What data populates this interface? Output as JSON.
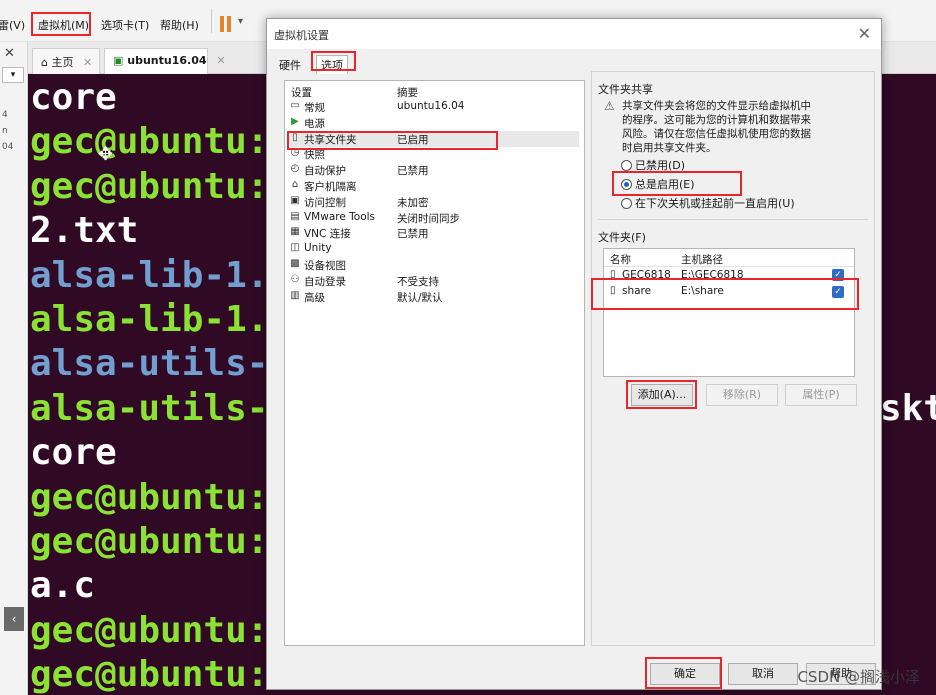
{
  "menubar": {
    "items": [
      "雷(V)",
      "虚拟机(M)",
      "选项卡(T)",
      "帮助(H)"
    ]
  },
  "left_strip": {
    "glyphs": [
      "4",
      "n",
      "04"
    ]
  },
  "tabs": [
    {
      "label": "主页"
    },
    {
      "label": "ubuntu16.04"
    }
  ],
  "terminal": {
    "lines": [
      {
        "text": "core",
        "color": "#ffffff"
      },
      {
        "text": "gec@ubuntu:",
        "color": "#8ae234"
      },
      {
        "text": "gec@ubuntu:",
        "color": "#8ae234"
      },
      {
        "text": "2.txt",
        "color": "#ffffff"
      },
      {
        "text": "alsa-lib-1.",
        "color": "#729fcf"
      },
      {
        "text": "alsa-lib-1.",
        "color": "#8ae234"
      },
      {
        "text": "alsa-utils-",
        "color": "#729fcf"
      },
      {
        "text": "alsa-utils-",
        "color": "#8ae234"
      },
      {
        "text": "core",
        "color": "#ffffff"
      },
      {
        "text": "gec@ubuntu:",
        "color": "#8ae234"
      },
      {
        "text": "gec@ubuntu:",
        "color": "#8ae234"
      },
      {
        "text": "a.c",
        "color": "#ffffff"
      },
      {
        "text": "gec@ubuntu:",
        "color": "#8ae234"
      },
      {
        "text": "gec@ubuntu:",
        "color": "#8ae234"
      }
    ],
    "right_fragment": "skt"
  },
  "dialog": {
    "title": "虚拟机设置",
    "tabs": [
      "硬件",
      "选项"
    ],
    "list_headers": [
      "设置",
      "摘要"
    ],
    "list_items": [
      {
        "icon": "monitor-icon",
        "glyph": "▭",
        "name": "常规",
        "summary": "ubuntu16.04"
      },
      {
        "icon": "power-icon",
        "glyph": "▶",
        "name": "电源",
        "summary": ""
      },
      {
        "icon": "shared-folder-icon",
        "glyph": "▯",
        "name": "共享文件夹",
        "summary": "已启用"
      },
      {
        "icon": "snapshot-icon",
        "glyph": "◷",
        "name": "快照",
        "summary": ""
      },
      {
        "icon": "autoprotect-icon",
        "glyph": "◴",
        "name": "自动保护",
        "summary": "已禁用"
      },
      {
        "icon": "guest-isolation-icon",
        "glyph": "⌂",
        "name": "客户机隔离",
        "summary": ""
      },
      {
        "icon": "access-control-icon",
        "glyph": "▣",
        "name": "访问控制",
        "summary": "未加密"
      },
      {
        "icon": "vmware-tools-icon",
        "glyph": "▤",
        "name": "VMware Tools",
        "summary": "关闭时间同步"
      },
      {
        "icon": "vnc-icon",
        "glyph": "▦",
        "name": "VNC 连接",
        "summary": "已禁用"
      },
      {
        "icon": "unity-icon",
        "glyph": "◫",
        "name": "Unity",
        "summary": ""
      },
      {
        "icon": "device-view-icon",
        "glyph": "▩",
        "name": "设备视图",
        "summary": ""
      },
      {
        "icon": "autologon-icon",
        "glyph": "⚇",
        "name": "自动登录",
        "summary": "不受支持"
      },
      {
        "icon": "advanced-icon",
        "glyph": "▥",
        "name": "高级",
        "summary": "默认/默认"
      }
    ],
    "sharing": {
      "group_label": "文件夹共享",
      "warning": [
        "共享文件夹会将您的文件显示给虚拟机中",
        "的程序。这可能为您的计算机和数据带来",
        "风险。请仅在您信任虚拟机使用您的数据",
        "时启用共享文件夹。"
      ],
      "options": [
        {
          "label": "已禁用(D)",
          "checked": false
        },
        {
          "label": "总是启用(E)",
          "checked": true
        },
        {
          "label": "在下次关机或挂起前一直启用(U)",
          "checked": false
        }
      ]
    },
    "folders": {
      "group_label": "文件夹(F)",
      "headers": [
        "名称",
        "主机路径"
      ],
      "rows": [
        {
          "name": "GEC6818",
          "path": "E:\\GEC6818",
          "enabled": true
        },
        {
          "name": "share",
          "path": "E:\\share",
          "enabled": true
        }
      ],
      "buttons": {
        "add": "添加(A)...",
        "remove": "移除(R)",
        "properties": "属性(P)"
      }
    },
    "footer": {
      "ok": "确定",
      "cancel": "取消",
      "help": "帮助"
    }
  },
  "watermark": "CSDN @搁浅小泽",
  "colors": {
    "highlight": "#e8262d",
    "terminal_bg": "#300a24",
    "accent": "#1a63c6"
  }
}
